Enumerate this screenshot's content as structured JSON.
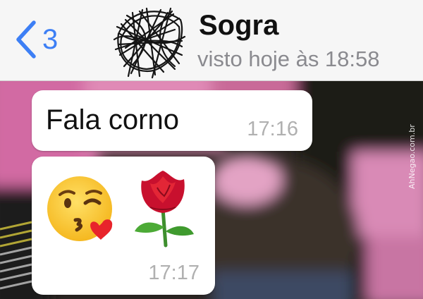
{
  "header": {
    "back_count": "3",
    "contact_name": "Sogra",
    "last_seen": "visto hoje às 18:58",
    "icons": {
      "back": "chevron-left-icon",
      "avatar": "scribbled-avatar"
    },
    "colors": {
      "accent": "#3d7ff5",
      "header_bg": "#f6f6f6"
    }
  },
  "messages": [
    {
      "type": "text",
      "text": "Fala corno",
      "time": "17:16"
    },
    {
      "type": "emoji",
      "emojis": [
        "kissing-face-with-heart-emoji",
        "rose-emoji"
      ],
      "time": "17:17"
    }
  ],
  "watermark": "AhNegao.com.br"
}
